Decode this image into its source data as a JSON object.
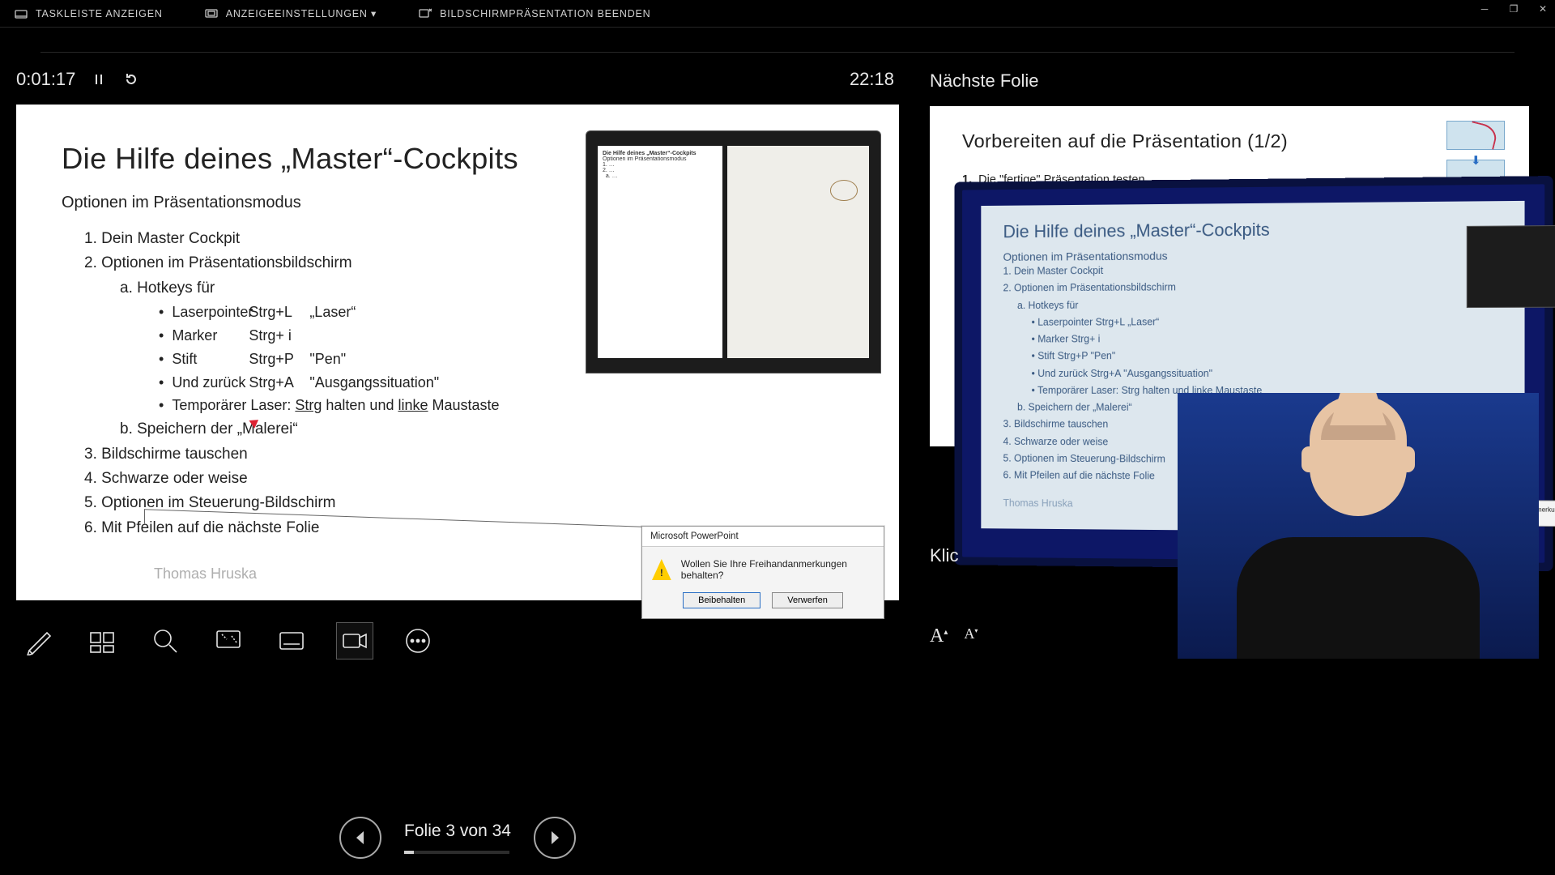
{
  "topbar": {
    "show_taskbar": "TASKLEISTE ANZEIGEN",
    "display_settings": "ANZEIGEEINSTELLUNGEN ▾",
    "end_show": "BILDSCHIRMPRÄSENTATION BEENDEN"
  },
  "timers": {
    "elapsed": "0:01:17",
    "clock": "22:18"
  },
  "slide": {
    "title": "Die Hilfe deines „Master“-Cockpits",
    "subtitle": "Optionen im Präsentationsmodus",
    "l1_1": "1. Dein Master Cockpit",
    "l1_2": "2. Optionen im Präsentationsbildschirm",
    "l2_a": "a. Hotkeys für",
    "b1_c1": "Laserpointer",
    "b1_c2": "Strg+L",
    "b1_c3": "„Laser“",
    "b2_c1": "Marker",
    "b2_c2": "Strg+ i",
    "b2_c3": "",
    "b3_c1": "Stift",
    "b3_c2": "Strg+P",
    "b3_c3": "\"Pen\"",
    "b4_c1": "Und zurück",
    "b4_c2": "Strg+A",
    "b4_c3": "\"Ausgangssituation\"",
    "b5_pre": "Temporärer Laser:  ",
    "b5_u1": "Strg",
    "b5_mid": " halten und ",
    "b5_u2": "linke",
    "b5_post": " Maustaste",
    "l2_b": "b.  Speichern der „Malerei“",
    "l1_3": "3. Bildschirme tauschen",
    "l1_4": "4. Schwarze oder weise",
    "l1_5": "5. Optionen im Steuerung-Bildschirm",
    "l1_6": "6. Mit Pfeilen auf die nächste Folie",
    "author": "Thomas Hruska"
  },
  "mini": {
    "title": "Die Hilfe deines „Master“-Cockpits",
    "sub": "Optionen im Präsentationsmodus"
  },
  "dialog": {
    "title": "Microsoft PowerPoint",
    "text": "Wollen Sie Ihre Freihandanmerkungen behalten?",
    "keep": "Beibehalten",
    "discard": "Verwerfen"
  },
  "nav": {
    "counter": "Folie 3 von 34"
  },
  "right": {
    "heading": "Nächste Folie",
    "next_title": "Vorbereiten auf die Präsentation (1/2)",
    "next_line1_n": "1.",
    "next_line1": "Die \"fertige\" Präsentation testen",
    "notes_prompt": "Klic"
  },
  "photo": {
    "title": "Die Hilfe deines „Master“-Cockpits",
    "sub": "Optionen im Präsentationsmodus",
    "l1": "1. Dein Master Cockpit",
    "l2": "2. Optionen im Präsentationsbildschirm",
    "la": "a. Hotkeys für",
    "b1": "• Laserpointer  Strg+L   „Laser“",
    "b2": "• Marker           Strg+ i",
    "b3": "• Stift               Strg+P   \"Pen\"",
    "b4": "• Und zurück    Strg+A   \"Ausgangssituation\"",
    "b5": "• Temporärer Laser:  Strg halten und linke Maustaste",
    "lb": "b. Speichern der „Malerei“",
    "l3": "3. Bildschirme tauschen",
    "l4": "4. Schwarze oder weise",
    "l5": "5. Optionen im Steuerung-Bildschirm",
    "l6": "6. Mit Pfeilen auf die nächste Folie",
    "author": "Thomas Hruska",
    "dlg": "Wollen Sie Ihre Freihandanmerkungen behalten?"
  }
}
